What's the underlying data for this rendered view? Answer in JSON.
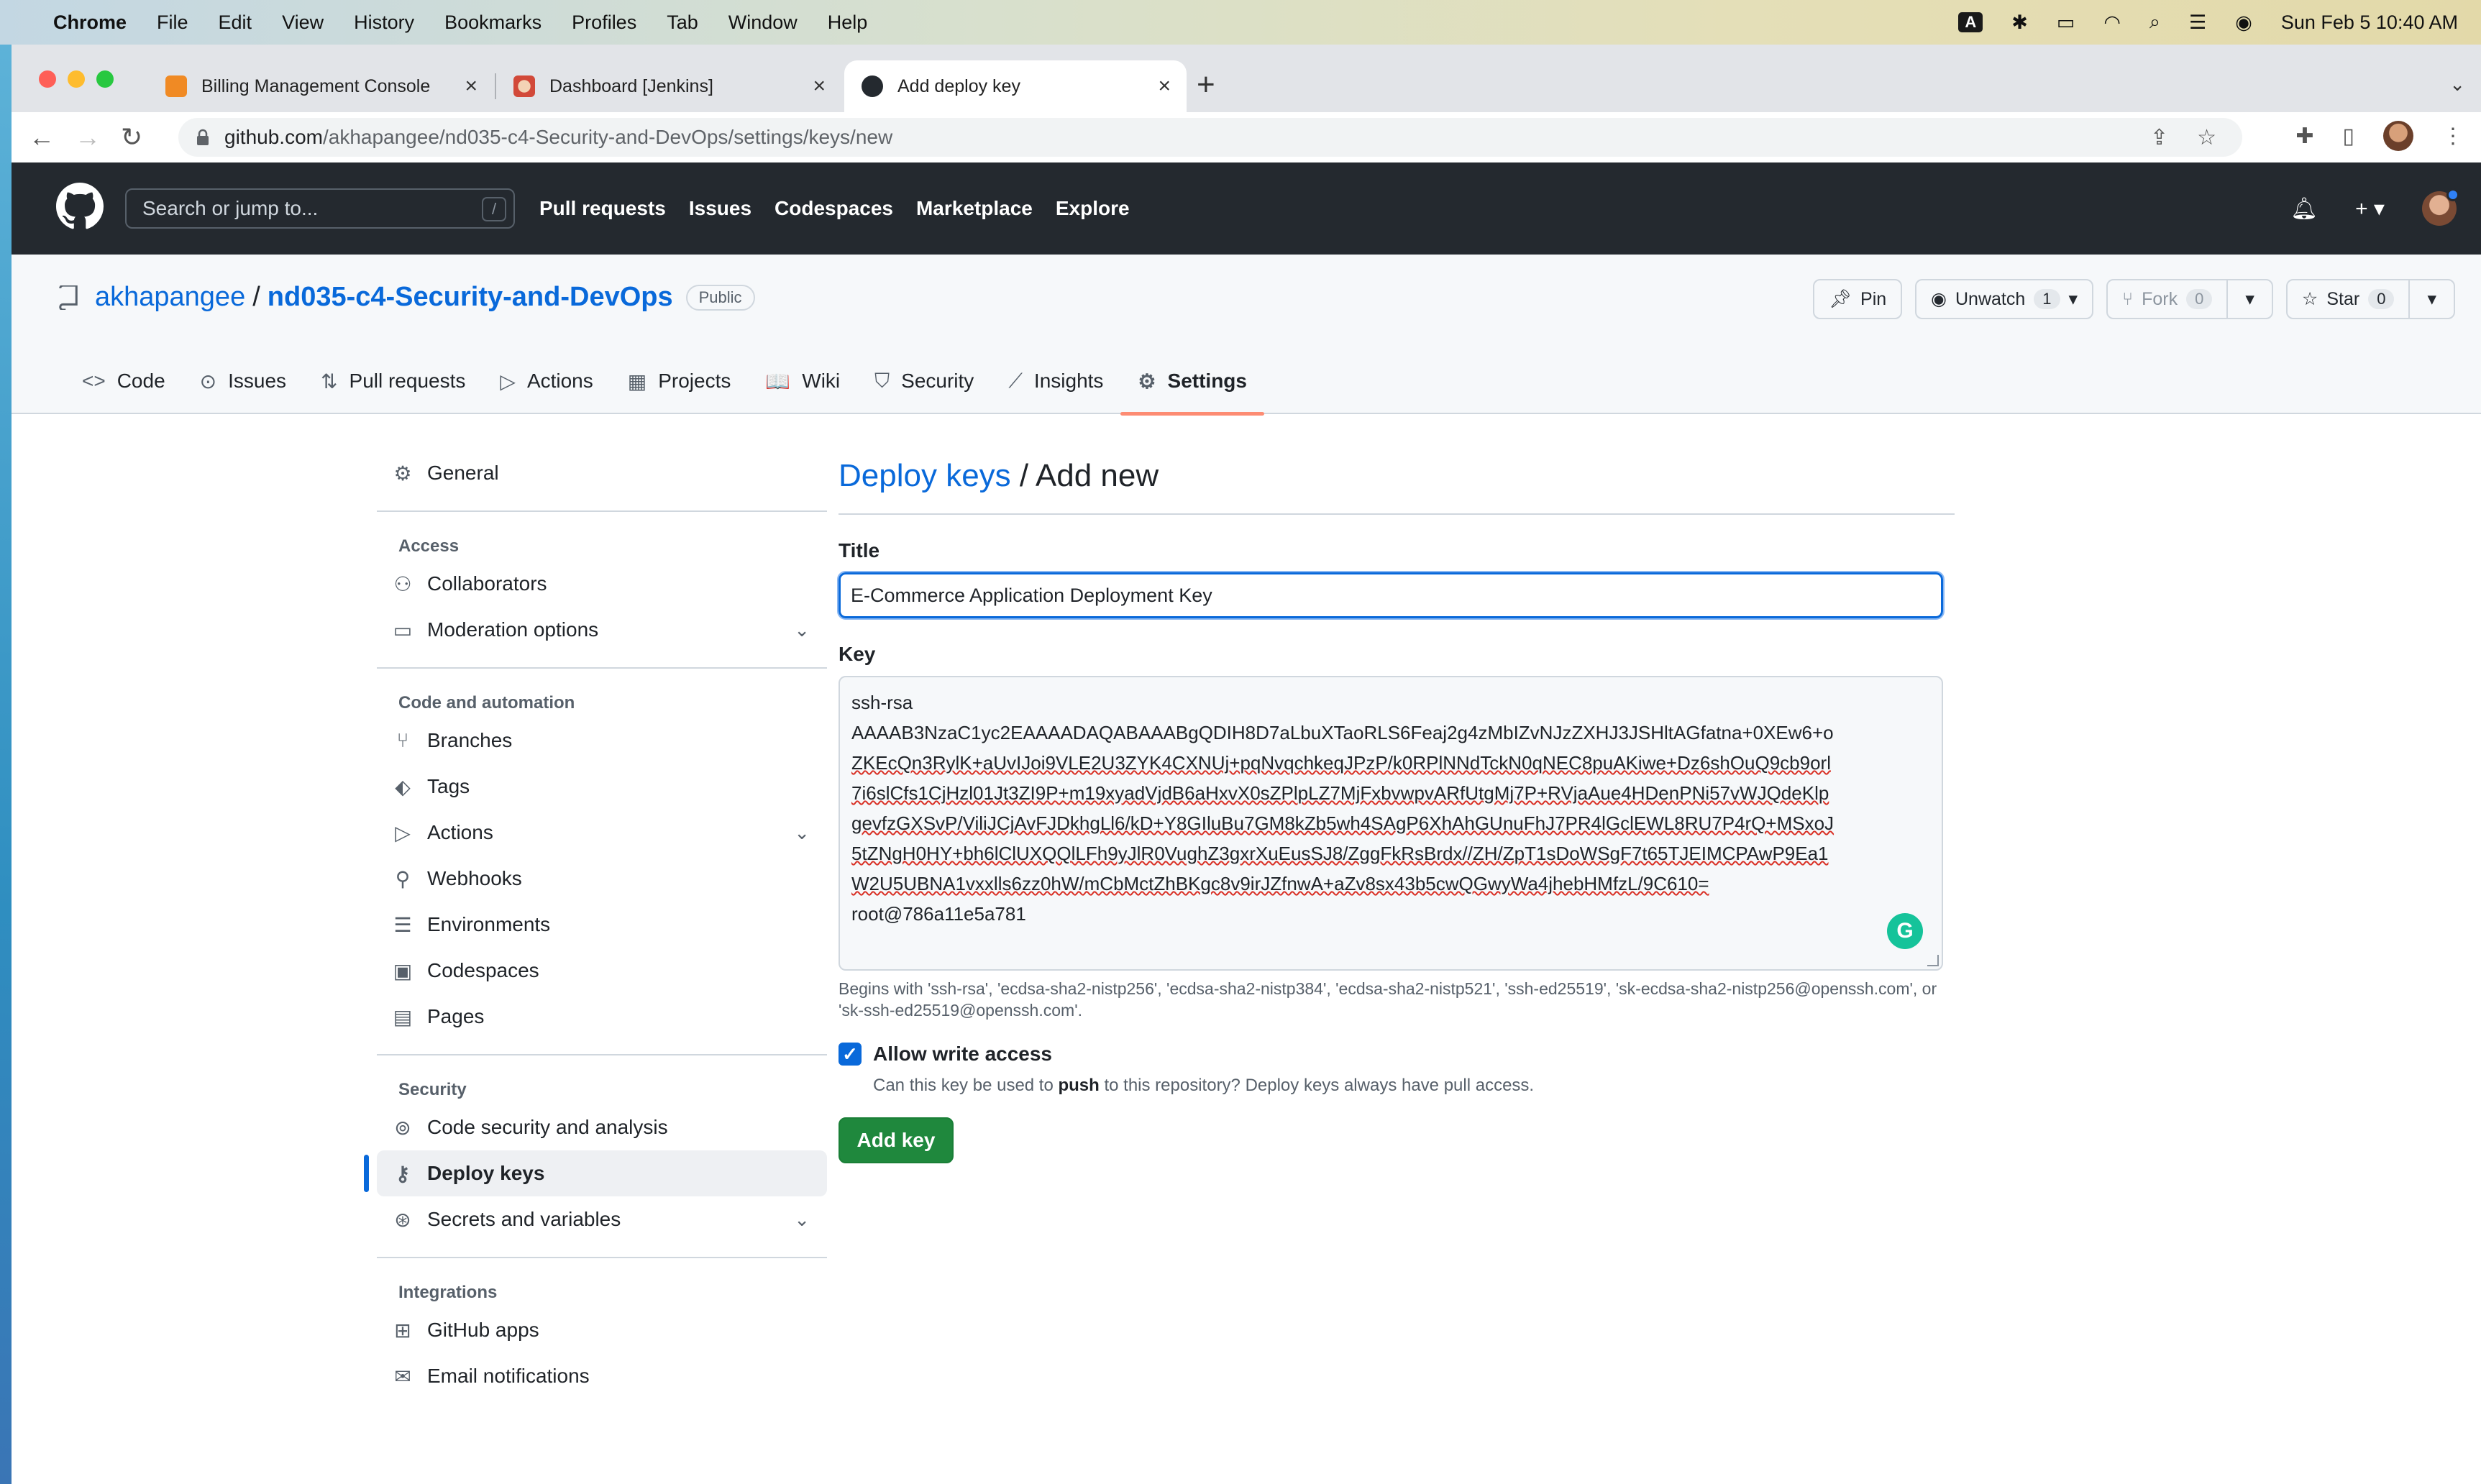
{
  "menubar": {
    "app": "Chrome",
    "items": [
      "File",
      "Edit",
      "View",
      "History",
      "Bookmarks",
      "Profiles",
      "Tab",
      "Window",
      "Help"
    ],
    "input_badge": "A",
    "datetime": "Sun Feb 5  10:40 AM"
  },
  "browser": {
    "tabs": [
      {
        "title": "Billing Management Console",
        "favicon_color": "#f08a24"
      },
      {
        "title": "Dashboard [Jenkins]",
        "favicon_color": "#d24939"
      },
      {
        "title": "Add deploy key",
        "favicon_color": "#24292f"
      }
    ],
    "url_host": "github.com",
    "url_path": "/akhapangee/nd035-c4-Security-and-DevOps/settings/keys/new"
  },
  "gh_header": {
    "search_placeholder": "Search or jump to...",
    "search_shortcut": "/",
    "nav": [
      "Pull requests",
      "Issues",
      "Codespaces",
      "Marketplace",
      "Explore"
    ]
  },
  "repo": {
    "owner": "akhapangee",
    "name": "nd035-c4-Security-and-DevOps",
    "visibility": "Public",
    "pin_label": "Pin",
    "unwatch_label": "Unwatch",
    "watch_count": "1",
    "fork_label": "Fork",
    "fork_count": "0",
    "star_label": "Star",
    "star_count": "0",
    "tabs": [
      {
        "label": "Code",
        "icon": "<>"
      },
      {
        "label": "Issues",
        "icon": "⊙"
      },
      {
        "label": "Pull requests",
        "icon": "⇅"
      },
      {
        "label": "Actions",
        "icon": "▷"
      },
      {
        "label": "Projects",
        "icon": "▦"
      },
      {
        "label": "Wiki",
        "icon": "📖"
      },
      {
        "label": "Security",
        "icon": "⛉"
      },
      {
        "label": "Insights",
        "icon": "⟋"
      },
      {
        "label": "Settings",
        "icon": "⚙"
      }
    ]
  },
  "sidebar": {
    "general": "General",
    "access_heading": "Access",
    "collaborators": "Collaborators",
    "moderation": "Moderation options",
    "code_heading": "Code and automation",
    "branches": "Branches",
    "tags": "Tags",
    "actions": "Actions",
    "webhooks": "Webhooks",
    "environments": "Environments",
    "codespaces": "Codespaces",
    "pages": "Pages",
    "security_heading": "Security",
    "code_security": "Code security and analysis",
    "deploy_keys": "Deploy keys",
    "secrets": "Secrets and variables",
    "integrations_heading": "Integrations",
    "github_apps": "GitHub apps",
    "email_notifications": "Email notifications"
  },
  "form": {
    "breadcrumb_link": "Deploy keys",
    "breadcrumb_rest": " / Add new",
    "title_label": "Title",
    "title_value": "E-Commerce Application Deployment Key",
    "key_label": "Key",
    "key_lines": [
      "ssh-rsa",
      "AAAAB3NzaC1yc2EAAAADAQABAAABgQDIH8D7aLbuXTaoRLS6Feaj2g4zMbIZvNJzZXHJ3JSHltAGfatna+0XEw6+o",
      "ZKEcQn3RylK+aUvIJoi9VLE2U3ZYK4CXNUj+pqNvqchkeqJPzP/k0RPlNNdTckN0qNEC8puAKiwe+Dz6shOuQ9cb9orl",
      "7i6slCfs1CjHzl01Jt3ZI9P+m19xyadVjdB6aHxvX0sZPlpLZ7MjFxbvwpvARfUtgMj7P+RVjaAue4HDenPNi57vWJQdeKlp",
      "gevfzGXSvP/ViliJCjAvFJDkhgLl6/kD+Y8GIluBu7GM8kZb5wh4SAgP6XhAhGUnuFhJ7PR4lGclEWL8RU7P4rQ+MSxoJ",
      "5tZNgH0HY+bh6lClUXQQlLFh9yJlR0VughZ3gxrXuEusSJ8/ZggFkRsBrdx//ZH/ZpT1sDoWSgF7t65TJEIMCPAwP9Ea1",
      "W2U5UBNA1vxxlls6zz0hW/mCbMctZhBKgc8v9irJZfnwA+aZv8sx43b5cwQGwyWa4jhebHMfzL/9C610=",
      "root@786a11e5a781"
    ],
    "key_hint": "Begins with 'ssh-rsa', 'ecdsa-sha2-nistp256', 'ecdsa-sha2-nistp384', 'ecdsa-sha2-nistp521', 'ssh-ed25519', 'sk-ecdsa-sha2-nistp256@openssh.com', or 'sk-ssh-ed25519@openssh.com'.",
    "allow_write_label": "Allow write access",
    "allow_write_checked": true,
    "note_pre": "Can this key be used to ",
    "note_bold": "push",
    "note_post": " to this repository? Deploy keys always have pull access.",
    "submit_label": "Add key"
  }
}
